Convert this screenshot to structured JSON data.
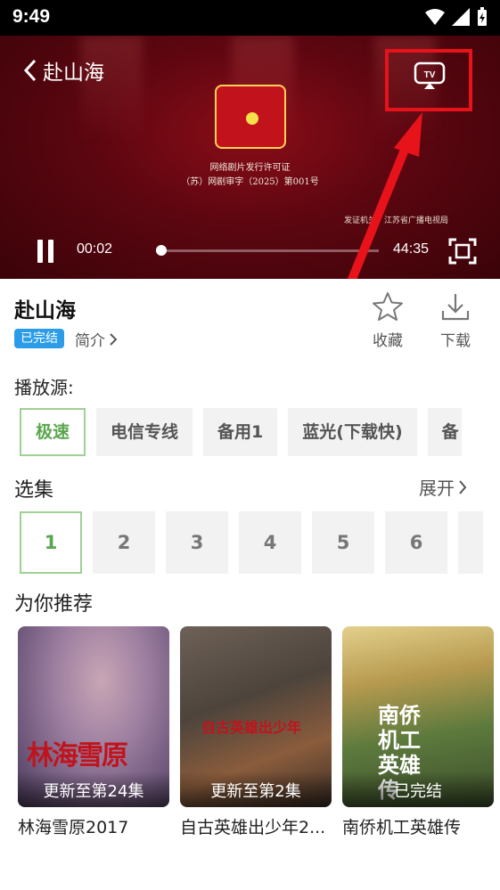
{
  "status_bar": {
    "time": "9:49"
  },
  "player": {
    "back_title": "赴山海",
    "license_line1": "网络剧片发行许可证",
    "license_line2": "（苏）网剧审字（2025）第001号",
    "issuer": "发证机关：江苏省广播电视局",
    "current_time": "00:02",
    "duration": "44:35",
    "progress": 0.001
  },
  "annotation": {
    "highlight_color": "#e8121b"
  },
  "show": {
    "title": "赴山海",
    "status_badge": "已完结",
    "intro_label": "简介",
    "favorite_label": "收藏",
    "download_label": "下载"
  },
  "sources": {
    "label": "播放源:",
    "items": [
      "极速",
      "电信专线",
      "备用1",
      "蓝光(下载快)",
      "备"
    ],
    "active_index": 0
  },
  "episodes": {
    "label": "选集",
    "expand_label": "展开",
    "items": [
      "1",
      "2",
      "3",
      "4",
      "5",
      "6"
    ],
    "active_index": 0
  },
  "recommend": {
    "label": "为你推荐",
    "items": [
      {
        "name": "林海雪原2017",
        "caption": "更新至第24集",
        "poster_title": "林海雪原"
      },
      {
        "name": "自古英雄出少年2...",
        "caption": "更新至第2集",
        "poster_title": "自古英雄出少年"
      },
      {
        "name": "南侨机工英雄传",
        "caption": "已完结",
        "poster_title": "南侨机工英雄传"
      }
    ]
  },
  "colors": {
    "accent_green": "#5aa64e",
    "badge_blue": "#2b9ce8"
  }
}
